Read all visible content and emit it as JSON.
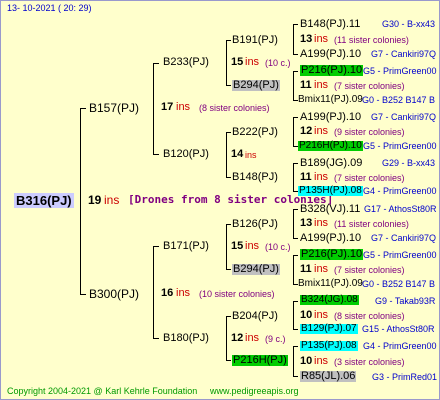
{
  "header": {
    "date": "13- 10-2021 ( 20: 29)"
  },
  "footer": {
    "copyright": "Copyright 2004-2021 @ Karl Kehrle Foundation",
    "site": "www.pedigreeapis.org"
  },
  "root": {
    "name": "B316(PJ)",
    "ins_num": "19",
    "ins": "ins",
    "note": "[Drones from 8 sister colonies]"
  },
  "gen1": [
    {
      "name": "B157(PJ)",
      "ins_num": "17",
      "ins": "ins",
      "note": "(8 sister colonies)"
    },
    {
      "name": "B300(PJ)",
      "ins_num": "16",
      "ins": "ins",
      "note": "(10 sister colonies)"
    }
  ],
  "gen2": [
    {
      "name": "B233(PJ)",
      "ins_num": "15",
      "ins": "ins",
      "note": "(10 c.)"
    },
    {
      "name": "B120(PJ)",
      "ins_num": "14",
      "ins": "ins",
      "note": ""
    },
    {
      "name": "B171(PJ)",
      "ins_num": "15",
      "ins": "ins",
      "note": "(10 c.)"
    },
    {
      "name": "B180(PJ)",
      "ins_num": "12",
      "ins": "ins",
      "note": "(9 c.)"
    }
  ],
  "gen3": [
    {
      "name": "B191(PJ)",
      "ins_num": "13",
      "ins": "ins",
      "note": "(10 c.)"
    },
    {
      "name": "B294(PJ)",
      "ins_num": "",
      "ins": "",
      "note": ""
    },
    {
      "name": "B222(PJ)",
      "ins_num": "12",
      "ins": "ins",
      "note": "(9 c.)"
    },
    {
      "name": "B148(PJ)",
      "ins_num": "",
      "ins": "",
      "note": ""
    },
    {
      "name": "B126(PJ)",
      "ins_num": "15",
      "ins": "ins",
      "note": "(10 c.)"
    },
    {
      "name": "B294(PJ)",
      "ins_num": "",
      "ins": "",
      "note": ""
    },
    {
      "name": "B204(PJ)",
      "ins_num": "",
      "ins": "",
      "note": ""
    },
    {
      "name": "P216H(PJ)",
      "ins_num": "",
      "ins": "",
      "note": ""
    }
  ],
  "gen4": [
    {
      "name": "B148(PJ).11",
      "ref": "G30 - B-xx43"
    },
    {
      "num": "13",
      "ins": "ins",
      "note": "(11 sister colonies)"
    },
    {
      "name": "A199(PJ).10",
      "ref": "G7 - Cankiri97Q"
    },
    {
      "name": "P216(PJ).10",
      "ref": "G5 - PrimGreen00"
    },
    {
      "num": "11",
      "ins": "ins",
      "note": "(7 sister colonies)"
    },
    {
      "name": "Bmix11(PJ).09",
      "ref": "G0 - B252 B147 B"
    },
    {
      "name": "A199(PJ).10",
      "ref": "G7 - Cankiri97Q"
    },
    {
      "num": "12",
      "ins": "ins",
      "note": "(9 sister colonies)"
    },
    {
      "name": "P216H(PJ).10",
      "ref": "G5 - PrimGreen00"
    },
    {
      "name": "B189(JG).09",
      "ref": "G29 - B-xx43"
    },
    {
      "num": "11",
      "ins": "ins",
      "note": "(7 sister colonies)"
    },
    {
      "name": "P135H(PJ).08",
      "ref": "G4 - PrimGreen00"
    },
    {
      "name": "B328(VJ).11",
      "ref": "G17 - AthosSt80R"
    },
    {
      "num": "13",
      "ins": "ins",
      "note": "(11 sister colonies)"
    },
    {
      "name": "A199(PJ).10",
      "ref": "G7 - Cankiri97Q"
    },
    {
      "name": "P216(PJ).10",
      "ref": "G5 - PrimGreen00"
    },
    {
      "num": "11",
      "ins": "ins",
      "note": "(7 sister colonies)"
    },
    {
      "name": "Bmix11(PJ).09",
      "ref": "G0 - B252 B147 B"
    },
    {
      "name": "B324(JG).08",
      "ref": "G9 - Takab93R"
    },
    {
      "num": "10",
      "ins": "ins",
      "note": "(8 sister colonies)"
    },
    {
      "name": "B129(PJ).07",
      "ref": "G15 - AthosSt80R"
    },
    {
      "name": "P135(PJ).08",
      "ref": "G4 - PrimGreen00"
    },
    {
      "num": "10",
      "ins": "ins",
      "note": "(3 sister colonies)"
    },
    {
      "name": "R85(JL).06",
      "ref": "G3 - PrimRed01"
    }
  ]
}
